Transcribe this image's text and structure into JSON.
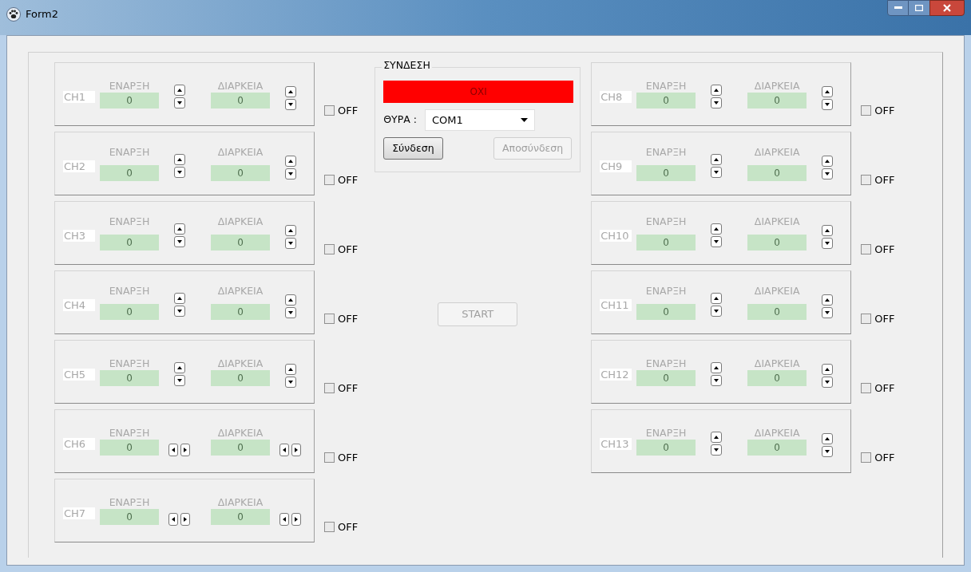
{
  "window": {
    "title": "Form2"
  },
  "channels_left": [
    {
      "label": "CH1",
      "start_label": "ΕΝΑΡΞΗ",
      "start_value": "0",
      "duration_label": "ΔΙΑΡΚΕΙΑ",
      "duration_value": "0",
      "kind": "vertical",
      "toggle": {
        "label": "OFF",
        "checked": false
      }
    },
    {
      "label": "CH2",
      "start_label": "ΕΝΑΡΞΗ",
      "start_value": "0",
      "duration_label": "ΔΙΑΡΚΕΙΑ",
      "duration_value": "0",
      "kind": "vertical",
      "toggle": {
        "label": "OFF",
        "checked": false
      }
    },
    {
      "label": "CH3",
      "start_label": "ΕΝΑΡΞΗ",
      "start_value": "0",
      "duration_label": "ΔΙΑΡΚΕΙΑ",
      "duration_value": "0",
      "kind": "vertical",
      "toggle": {
        "label": "OFF",
        "checked": false
      }
    },
    {
      "label": "CH4",
      "start_label": "ΕΝΑΡΞΗ",
      "start_value": "0",
      "duration_label": "ΔΙΑΡΚΕΙΑ",
      "duration_value": "0",
      "kind": "vertical",
      "toggle": {
        "label": "OFF",
        "checked": false
      }
    },
    {
      "label": "CH5",
      "start_label": "ΕΝΑΡΞΗ",
      "start_value": "0",
      "duration_label": "ΔΙΑΡΚΕΙΑ",
      "duration_value": "0",
      "kind": "vertical",
      "toggle": {
        "label": "OFF",
        "checked": false
      }
    },
    {
      "label": "CH6",
      "start_label": "ΕΝΑΡΞΗ",
      "start_value": "0",
      "duration_label": "ΔΙΑΡΚΕΙΑ",
      "duration_value": "0",
      "kind": "horizontal",
      "toggle": {
        "label": "OFF",
        "checked": false
      }
    },
    {
      "label": "CH7",
      "start_label": "ΕΝΑΡΞΗ",
      "start_value": "0",
      "duration_label": "ΔΙΑΡΚΕΙΑ",
      "duration_value": "0",
      "kind": "horizontal",
      "toggle": {
        "label": "OFF",
        "checked": false
      }
    }
  ],
  "connection": {
    "title": "ΣΥΝΔΕΣΗ",
    "status": "ΟΧΙ",
    "port_label": "ΘΥΡΑ :",
    "port_value": "COM1",
    "buttons": [
      {
        "label": "Σύνδεση",
        "disabled": false
      },
      {
        "label": "Αποσύνδεση",
        "disabled": true
      }
    ]
  },
  "start_button": {
    "label": "START",
    "disabled": true
  },
  "channels_right": [
    {
      "label": "CH8",
      "start_label": "ΕΝΑΡΞΗ",
      "start_value": "0",
      "duration_label": "ΔΙΑΡΚΕΙΑ",
      "duration_value": "0",
      "kind": "vertical",
      "toggle": {
        "label": "OFF",
        "checked": false
      }
    },
    {
      "label": "CH9",
      "start_label": "ΕΝΑΡΞΗ",
      "start_value": "0",
      "duration_label": "ΔΙΑΡΚΕΙΑ",
      "duration_value": "0",
      "kind": "vertical",
      "toggle": {
        "label": "OFF",
        "checked": false
      }
    },
    {
      "label": "CH10",
      "start_label": "ΕΝΑΡΞΗ",
      "start_value": "0",
      "duration_label": "ΔΙΑΡΚΕΙΑ",
      "duration_value": "0",
      "kind": "vertical",
      "toggle": {
        "label": "OFF",
        "checked": false
      }
    },
    {
      "label": "CH11",
      "start_label": "ΕΝΑΡΞΗ",
      "start_value": "0",
      "duration_label": "ΔΙΑΡΚΕΙΑ",
      "duration_value": "0",
      "kind": "vertical",
      "toggle": {
        "label": "OFF",
        "checked": false
      }
    },
    {
      "label": "CH12",
      "start_label": "ΕΝΑΡΞΗ",
      "start_value": "0",
      "duration_label": "ΔΙΑΡΚΕΙΑ",
      "duration_value": "0",
      "kind": "vertical",
      "toggle": {
        "label": "OFF",
        "checked": false
      }
    },
    {
      "label": "CH13",
      "start_label": "ΕΝΑΡΞΗ",
      "start_value": "0",
      "duration_label": "ΔΙΑΡΚΕΙΑ",
      "duration_value": "0",
      "kind": "vertical",
      "toggle": {
        "label": "OFF",
        "checked": false
      }
    }
  ]
}
